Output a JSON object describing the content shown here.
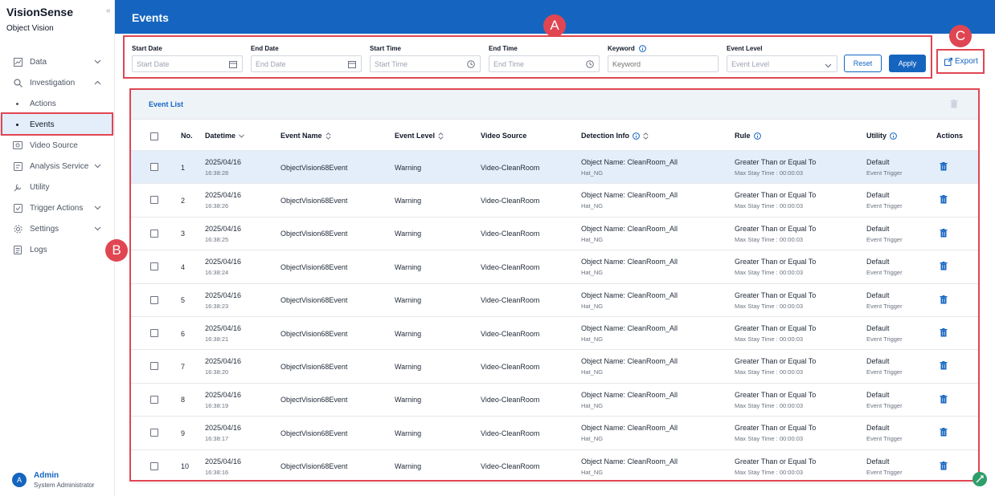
{
  "app": {
    "name": "VisionSense",
    "subtitle": "Object Vision",
    "collapse_glyph": "«"
  },
  "sidebar": {
    "items": [
      {
        "label": "Data",
        "icon": "chart-icon",
        "expandable": true
      },
      {
        "label": "Investigation",
        "icon": "search-icon",
        "expandable": true,
        "expanded": true
      },
      {
        "label": "Actions",
        "sub": true
      },
      {
        "label": "Events",
        "sub": true,
        "active": true
      },
      {
        "label": "Video Source",
        "icon": "video-icon"
      },
      {
        "label": "Analysis Service",
        "icon": "analysis-icon",
        "expandable": true
      },
      {
        "label": "Utility",
        "icon": "utility-icon"
      },
      {
        "label": "Trigger Actions",
        "icon": "trigger-icon",
        "expandable": true
      },
      {
        "label": "Settings",
        "icon": "gear-icon",
        "expandable": true
      },
      {
        "label": "Logs",
        "icon": "logs-icon"
      }
    ]
  },
  "user": {
    "initial": "A",
    "name": "Admin",
    "role": "System Administrator"
  },
  "header": {
    "title": "Events"
  },
  "filters": {
    "start_date": {
      "label": "Start Date",
      "placeholder": "Start Date"
    },
    "end_date": {
      "label": "End Date",
      "placeholder": "End Date"
    },
    "start_time": {
      "label": "Start Time",
      "placeholder": "Start Time"
    },
    "end_time": {
      "label": "End Time",
      "placeholder": "End Time"
    },
    "keyword": {
      "label": "Keyword",
      "placeholder": "Keyword"
    },
    "event_level": {
      "label": "Event Level",
      "placeholder": "Event Level"
    },
    "reset_label": "Reset",
    "apply_label": "Apply"
  },
  "export": {
    "label": "Export"
  },
  "event_list": {
    "title": "Event List",
    "columns": [
      "No.",
      "Datetime",
      "Event Name",
      "Event Level",
      "Video Source",
      "Detection Info",
      "Rule",
      "Utility",
      "Actions"
    ],
    "rows": [
      {
        "no": "1",
        "date": "2025/04/16",
        "time": "16:38:28",
        "name": "ObjectVision68Event",
        "level": "Warning",
        "source": "Video-CleanRoom",
        "det": "Object Name: CleanRoom_All",
        "det_sub": "Hat_NG",
        "rule": "Greater Than or Equal To",
        "rule_sub": "Max Stay Time : 00:00:03",
        "utility": "Default",
        "utility_sub": "Event Trigger"
      },
      {
        "no": "2",
        "date": "2025/04/16",
        "time": "16:38:26",
        "name": "ObjectVision68Event",
        "level": "Warning",
        "source": "Video-CleanRoom",
        "det": "Object Name: CleanRoom_All",
        "det_sub": "Hat_NG",
        "rule": "Greater Than or Equal To",
        "rule_sub": "Max Stay Time : 00:00:03",
        "utility": "Default",
        "utility_sub": "Event Trigger"
      },
      {
        "no": "3",
        "date": "2025/04/16",
        "time": "16:38:25",
        "name": "ObjectVision68Event",
        "level": "Warning",
        "source": "Video-CleanRoom",
        "det": "Object Name: CleanRoom_All",
        "det_sub": "Hat_NG",
        "rule": "Greater Than or Equal To",
        "rule_sub": "Max Stay Time : 00:00:03",
        "utility": "Default",
        "utility_sub": "Event Trigger"
      },
      {
        "no": "4",
        "date": "2025/04/16",
        "time": "16:38:24",
        "name": "ObjectVision68Event",
        "level": "Warning",
        "source": "Video-CleanRoom",
        "det": "Object Name: CleanRoom_All",
        "det_sub": "Hat_NG",
        "rule": "Greater Than or Equal To",
        "rule_sub": "Max Stay Time : 00:00:03",
        "utility": "Default",
        "utility_sub": "Event Trigger"
      },
      {
        "no": "5",
        "date": "2025/04/16",
        "time": "16:38:23",
        "name": "ObjectVision68Event",
        "level": "Warning",
        "source": "Video-CleanRoom",
        "det": "Object Name: CleanRoom_All",
        "det_sub": "Hat_NG",
        "rule": "Greater Than or Equal To",
        "rule_sub": "Max Stay Time : 00:00:03",
        "utility": "Default",
        "utility_sub": "Event Trigger"
      },
      {
        "no": "6",
        "date": "2025/04/16",
        "time": "16:38:21",
        "name": "ObjectVision68Event",
        "level": "Warning",
        "source": "Video-CleanRoom",
        "det": "Object Name: CleanRoom_All",
        "det_sub": "Hat_NG",
        "rule": "Greater Than or Equal To",
        "rule_sub": "Max Stay Time : 00:00:03",
        "utility": "Default",
        "utility_sub": "Event Trigger"
      },
      {
        "no": "7",
        "date": "2025/04/16",
        "time": "16:38:20",
        "name": "ObjectVision68Event",
        "level": "Warning",
        "source": "Video-CleanRoom",
        "det": "Object Name: CleanRoom_All",
        "det_sub": "Hat_NG",
        "rule": "Greater Than or Equal To",
        "rule_sub": "Max Stay Time : 00:00:03",
        "utility": "Default",
        "utility_sub": "Event Trigger"
      },
      {
        "no": "8",
        "date": "2025/04/16",
        "time": "16:38:19",
        "name": "ObjectVision68Event",
        "level": "Warning",
        "source": "Video-CleanRoom",
        "det": "Object Name: CleanRoom_All",
        "det_sub": "Hat_NG",
        "rule": "Greater Than or Equal To",
        "rule_sub": "Max Stay Time : 00:00:03",
        "utility": "Default",
        "utility_sub": "Event Trigger"
      },
      {
        "no": "9",
        "date": "2025/04/16",
        "time": "16:38:17",
        "name": "ObjectVision68Event",
        "level": "Warning",
        "source": "Video-CleanRoom",
        "det": "Object Name: CleanRoom_All",
        "det_sub": "Hat_NG",
        "rule": "Greater Than or Equal To",
        "rule_sub": "Max Stay Time : 00:00:03",
        "utility": "Default",
        "utility_sub": "Event Trigger"
      },
      {
        "no": "10",
        "date": "2025/04/16",
        "time": "16:38:16",
        "name": "ObjectVision68Event",
        "level": "Warning",
        "source": "Video-CleanRoom",
        "det": "Object Name: CleanRoom_All",
        "det_sub": "Hat_NG",
        "rule": "Greater Than or Equal To",
        "rule_sub": "Max Stay Time : 00:00:03",
        "utility": "Default",
        "utility_sub": "Event Trigger"
      }
    ]
  },
  "markers": {
    "a": "A",
    "b": "B",
    "c": "C"
  },
  "colors": {
    "primary": "#1565c0",
    "highlight": "#e04652",
    "row_selected": "#e3eefa"
  }
}
